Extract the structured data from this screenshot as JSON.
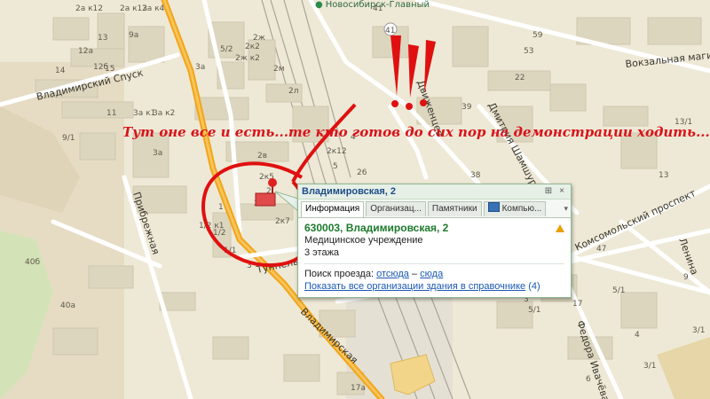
{
  "map": {
    "metro_station": "Новосибирск-Главный",
    "metro_symbol": "м",
    "streets": {
      "vladimirskiy_spusk": "Владимирский Спуск",
      "vokzalnaya": "Вокзальная магист",
      "dmitriya_shamshurina": "Дмитрия Шамшурина",
      "dvizhentsev": "Движенцев",
      "komsomolskiy": "Комсомольский проспект",
      "pribrezhnaya": "Прибрежная",
      "tunnelnaya": "Туннельн",
      "vladimirskaya": "Владимирская",
      "fedora_ivacheva": "Федора Ивачёва",
      "lenina": "Ленина"
    },
    "house_numbers": [
      "2а к12",
      "2а к13",
      "2а к4",
      "9а",
      "13",
      "12а",
      "14",
      "12б",
      "15",
      "2ж",
      "5/2",
      "2к2",
      "2ж к2",
      "2м",
      "2л",
      "3а",
      "3а к1",
      "3а к2",
      "11",
      "9/1",
      "3а",
      "2в",
      "2к12",
      "2к5",
      "2",
      "2а",
      "2к7",
      "1/2 к1",
      "1/2",
      "1",
      "1/1",
      "3",
      "4",
      "5",
      "40б",
      "40а",
      "41",
      "39",
      "53",
      "59",
      "22",
      "13/1",
      "13",
      "26",
      "38",
      "47",
      "3",
      "2",
      "5/1",
      "9",
      "17а",
      "17",
      "6",
      "4",
      "3/1",
      "9",
      "3/1",
      "5/1"
    ],
    "building_number_marker": "1"
  },
  "annotation": {
    "exclaim": "!!!",
    "text": "Тут оне все и есть...те кто готов до сих пор на демонстрации ходить...:-)))"
  },
  "popup": {
    "title": "Владимировская, 2",
    "pin_button": "⊞",
    "close_button": "×",
    "tabs": [
      "Информация",
      "Организац...",
      "Памятники",
      "Компью..."
    ],
    "tab_more": "▾",
    "address": "630003, Владимировская, 2",
    "lines": [
      "Медицинское учреждение",
      "3 этажа"
    ],
    "route_label": "Поиск проезда:",
    "route_from": "отсюда",
    "route_dash": "–",
    "route_to": "сюда",
    "show_all": "Показать все организации здания в справочнике",
    "show_all_count": "(4)"
  },
  "colors": {
    "map_bg": "#eee9d6",
    "building": "#ddd6bf",
    "main_road": "#f2a51a",
    "annotation_red": "#d8131a",
    "popup_border": "#8fb78f"
  }
}
